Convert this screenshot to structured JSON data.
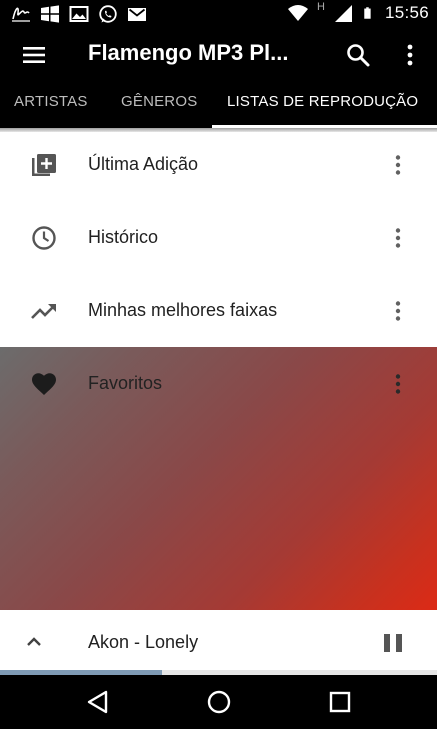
{
  "status_bar": {
    "time": "15:56",
    "network_label": "H",
    "left_icons": [
      "signature-app-icon",
      "windows-icon",
      "gallery-icon",
      "whatsapp-icon",
      "gmail-icon"
    ],
    "right_icons": [
      "wifi-icon",
      "signal-icon",
      "battery-icon"
    ]
  },
  "app_bar": {
    "title": "Flamengo MP3 Pl...",
    "icons": [
      "menu-icon",
      "search-icon",
      "more-vert-icon"
    ]
  },
  "tabs": [
    {
      "label": "ARTISTAS",
      "active": false
    },
    {
      "label": "GÊNEROS",
      "active": false
    },
    {
      "label": "LISTAS DE REPRODUÇÃO",
      "active": true
    }
  ],
  "playlists": [
    {
      "label": "Última Adição",
      "icon": "playlist-add-icon"
    },
    {
      "label": "Histórico",
      "icon": "history-clock-icon"
    },
    {
      "label": "Minhas melhores faixas",
      "icon": "trending-up-icon"
    },
    {
      "label": "Favoritos",
      "icon": "heart-icon"
    }
  ],
  "now_playing": {
    "title": "Akon - Lonely",
    "state": "playing",
    "progress_fraction": 0.37
  },
  "navigation": {
    "buttons": [
      "back-icon",
      "home-icon",
      "recents-icon"
    ]
  },
  "colors": {
    "bar_background": "#000000",
    "list_background": "#ffffff",
    "gradient_start": "#6c6c6c",
    "gradient_end": "#dc2a16",
    "progress_fill": "#7f9bb5"
  }
}
